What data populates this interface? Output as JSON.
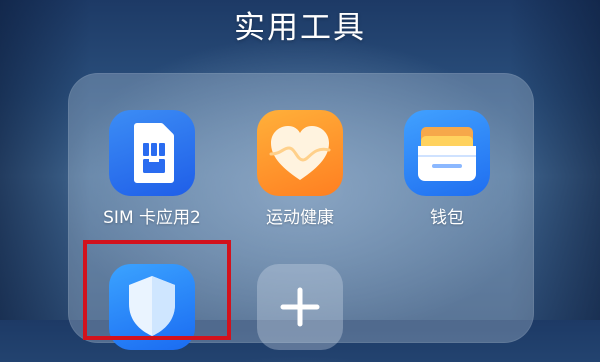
{
  "folder": {
    "title": "实用工具",
    "apps": [
      {
        "label": "SIM 卡应用2",
        "icon": "sim-card-icon"
      },
      {
        "label": "运动健康",
        "icon": "health-heart-icon"
      },
      {
        "label": "钱包",
        "icon": "wallet-icon"
      },
      {
        "label": "",
        "icon": "security-shield-icon"
      },
      {
        "label": "",
        "icon": "add-plus-icon"
      }
    ]
  },
  "colors": {
    "highlight": "#d2121d",
    "sim_blue": "#1f5ee8",
    "health_orange": "#ff7f21",
    "wallet_blue": "#1f6ef0"
  }
}
